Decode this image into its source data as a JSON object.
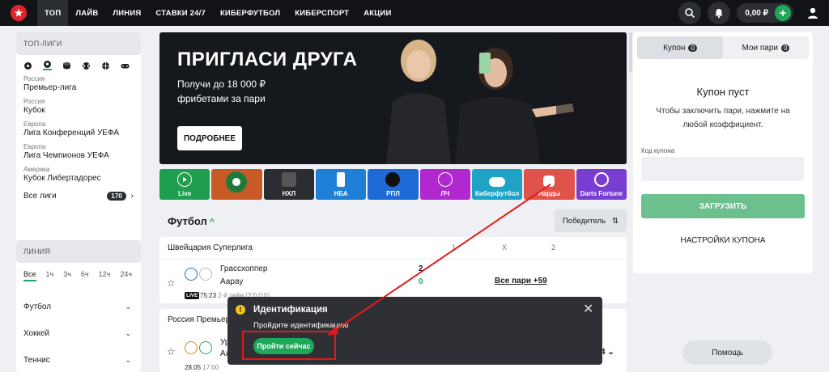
{
  "nav": {
    "items": [
      "ТОП",
      "ЛАЙВ",
      "ЛИНИЯ",
      "СТАВКИ 24/7",
      "КИБЕРФУТБОЛ",
      "КИБЕРСПОРТ",
      "АКЦИИ"
    ],
    "active_index": 0,
    "balance": "0,00 ₽"
  },
  "sidebar": {
    "top_leagues_header": "ТОП-ЛИГИ",
    "leagues": [
      {
        "country": "Россия",
        "name": "Премьер-лига"
      },
      {
        "country": "Россия",
        "name": "Кубок"
      },
      {
        "country": "Европа",
        "name": "Лига Конференций УЕФА"
      },
      {
        "country": "Европа",
        "name": "Лига Чемпионов УЕФА"
      },
      {
        "country": "Америка",
        "name": "Кубок Либертадорес"
      }
    ],
    "all_leagues_label": "Все лиги",
    "all_leagues_count": "170",
    "line_header": "ЛИНИЯ",
    "time_filters": [
      "Все",
      "1ч",
      "3ч",
      "6ч",
      "12ч",
      "24ч"
    ],
    "sports": [
      "Футбол",
      "Хоккей",
      "Теннис"
    ]
  },
  "banner": {
    "title": "ПРИГЛАСИ ДРУГА",
    "subtitle": "Получи до 18 000 ₽ фрибетами за пари",
    "button": "ПОДРОБНЕЕ"
  },
  "tiles": [
    {
      "label": "Live",
      "color": "#1f9e4f"
    },
    {
      "label": "",
      "color": "#c85a26"
    },
    {
      "label": "НХЛ",
      "color": "#2a2d31"
    },
    {
      "label": "НБА",
      "color": "#1e7fd6"
    },
    {
      "label": "РПЛ",
      "color": "#1e6ad6"
    },
    {
      "label": "ЛЧ",
      "color": "#b128d0"
    },
    {
      "label": "Киберфутбол",
      "color": "#1ea3c7"
    },
    {
      "label": "Нарды",
      "color": "#e0534a"
    },
    {
      "label": "Darts Fortune",
      "color": "#7a3dd1"
    }
  ],
  "football": {
    "title": "Футбол",
    "sort_label": "Победитель",
    "league1": {
      "country": "Швейцария",
      "name": "Суперлига",
      "cols": [
        "1",
        "X",
        "2"
      ],
      "team1": "Грассхоппер",
      "team2": "Аарау",
      "score1": "2",
      "score2": "0",
      "more": "Все пари +59",
      "live": "LIVE",
      "time": "75:23",
      "period": "2-й тайм (2:0,0:0)"
    },
    "league2": {
      "country": "Россия",
      "name": "Премьер",
      "team1": "Ур",
      "team2": "Ах",
      "date": "28.05",
      "time": "17:00",
      "more_tail": "4"
    }
  },
  "coupon": {
    "tab_coupon": "Купон",
    "tab_coupon_count": "0",
    "tab_my": "Мои пари",
    "tab_my_count": "0",
    "empty_title": "Купон пуст",
    "empty_desc": "Чтобы заключить пари, нажмите на любой коэффициент.",
    "code_label": "Код купона",
    "load_button": "ЗАГРУЗИТЬ",
    "settings": "НАСТРОЙКИ КУПОНА"
  },
  "help_button": "Помощь",
  "toast": {
    "title": "Идентификация",
    "text": "Пройдите идентификацию",
    "button": "Пройти сейчас"
  }
}
